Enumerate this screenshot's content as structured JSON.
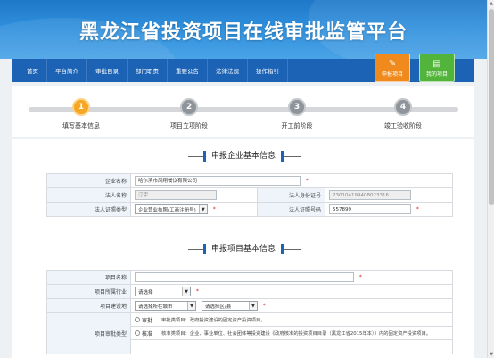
{
  "header": {
    "title": "黑龙江省投资项目在线审批监管平台"
  },
  "nav": {
    "items": [
      "首页",
      "平台简介",
      "审批目录",
      "部门职责",
      "重要公告",
      "法律法规",
      "操作指引"
    ]
  },
  "quick_buttons": {
    "apply": {
      "label": "申报项目",
      "icon": "edit-icon"
    },
    "mine": {
      "label": "我的项目",
      "icon": "document-icon"
    }
  },
  "steps": [
    {
      "num": "1",
      "label": "填写基本信息",
      "active": true
    },
    {
      "num": "2",
      "label": "项目立项阶段",
      "active": false
    },
    {
      "num": "3",
      "label": "开工前阶段",
      "active": false
    },
    {
      "num": "4",
      "label": "竣工验收阶段",
      "active": false
    }
  ],
  "company_section": {
    "title": "申报企业基本信息",
    "company_name_label": "企业名称",
    "company_name_value": "哈尔滨市凤翔餐饮有限公司",
    "legal_person_label": "法人名称",
    "legal_person_value": "汀宇",
    "legal_id_label": "法人身份证号",
    "legal_id_value": "230104199408023316",
    "cert_type_label": "法人证照类型",
    "cert_type_value": "企业营业执照(工商注册号)",
    "cert_no_label": "法人证照号码",
    "cert_no_value": "557899"
  },
  "project_section": {
    "title": "申报项目基本信息",
    "name_label": "项目名称",
    "name_value": "",
    "industry_label": "项目所属行业",
    "industry_value": "请选择",
    "location_label": "项目建设地",
    "city_value": "请选择所在城市",
    "district_value": "请选择区/县",
    "type_label": "项目审批类型",
    "options": [
      {
        "name": "审批",
        "desc": "审批类项目：政府投资建设的固定资产投资项目。"
      },
      {
        "name": "核准",
        "desc": "核准类项目：企业、事业单位、社会团体等投资建设《政府核准的投资项目目录（黑龙江省2015年本）》内的固定资产投资项目。"
      }
    ]
  },
  "required_mark": "*"
}
